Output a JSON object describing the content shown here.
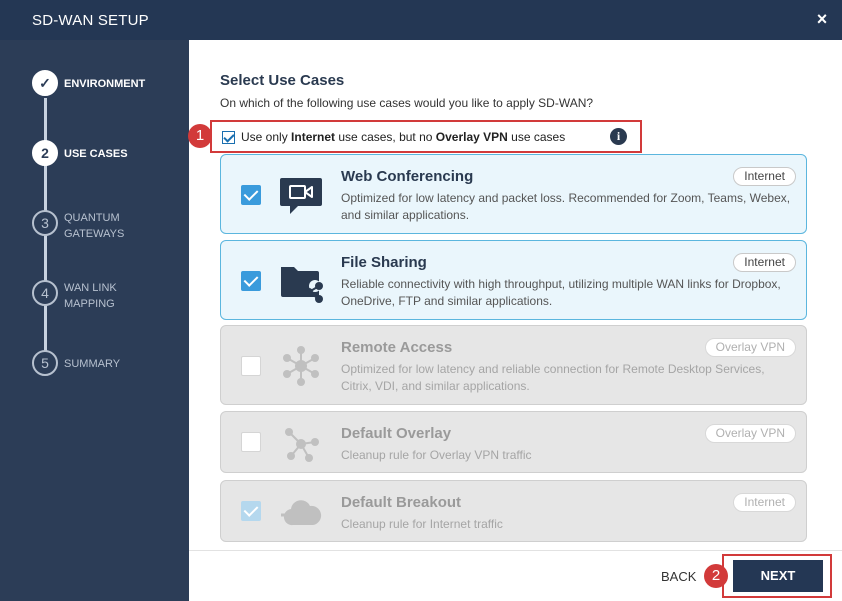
{
  "window": {
    "title": "SD-WAN SETUP",
    "close": "×"
  },
  "steps": [
    {
      "num": "✓",
      "label": "ENVIRONMENT",
      "state": "done"
    },
    {
      "num": "2",
      "label": "USE CASES",
      "state": "current"
    },
    {
      "num": "3",
      "label": "QUANTUM GATEWAYS",
      "state": "todo"
    },
    {
      "num": "4",
      "label": "WAN LINK MAPPING",
      "state": "todo"
    },
    {
      "num": "5",
      "label": "SUMMARY",
      "state": "todo"
    }
  ],
  "main": {
    "heading": "Select Use Cases",
    "subheading": "On which of the following use cases would you like to apply SD-WAN?",
    "option": {
      "pre": "Use only ",
      "bold1": "Internet",
      "mid": " use cases, but no ",
      "bold2": "Overlay VPN",
      "post": " use cases",
      "info": "i",
      "checked": true
    },
    "callouts": {
      "first": "1",
      "second": "2"
    },
    "cards": [
      {
        "name": "Web Conferencing",
        "desc": "Optimized for low latency and packet loss. Recommended for Zoom, Teams, Webex, and similar applications.",
        "tag": "Internet",
        "state": "selected",
        "icon": "video-chat-icon"
      },
      {
        "name": "File Sharing",
        "desc": "Reliable connectivity with high throughput, utilizing multiple WAN links for Dropbox, OneDrive, FTP and similar applications.",
        "tag": "Internet",
        "state": "selected",
        "icon": "folder-share-icon"
      },
      {
        "name": "Remote Access",
        "desc": "Optimized for low latency and reliable connection for Remote Desktop Services, Citrix, VDI, and similar applications.",
        "tag": "Overlay VPN",
        "state": "disabled",
        "icon": "network-hub-icon"
      },
      {
        "name": "Default Overlay",
        "desc": "Cleanup rule for Overlay VPN traffic",
        "tag": "Overlay VPN",
        "state": "disabled",
        "icon": "overlay-nodes-icon"
      },
      {
        "name": "Default Breakout",
        "desc": "Cleanup rule for Internet traffic",
        "tag": "Internet",
        "state": "disabled-checked",
        "icon": "cloud-breakout-icon"
      }
    ]
  },
  "footer": {
    "back": "BACK",
    "next": "NEXT"
  },
  "colors": {
    "navy": "#243754",
    "sidebar": "#2c3d57",
    "accent": "#3a9bdc",
    "callout": "#d23a3a"
  }
}
